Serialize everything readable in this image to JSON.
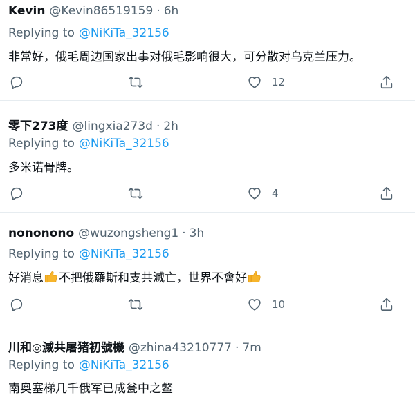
{
  "colors": {
    "mention": "#1d9bf0",
    "secondary_text": "#536471",
    "primary_text": "#0f1419",
    "divider": "#e6ecf0",
    "emoji": "#f7b52b"
  },
  "icons": [
    "reply-icon",
    "retweet-icon",
    "like-icon",
    "share-icon",
    "thumbs-up-emoji"
  ],
  "replies": [
    {
      "name": "Kevin",
      "handle": "@Kevin86519159",
      "dot": "·",
      "time": "6h",
      "replying_label": "Replying to",
      "replying_to": "@NiKiTa_32156",
      "text": "非常好，俄毛周边国家出事对俄毛影响很大，可分散对乌克兰压力。",
      "likes": "12"
    },
    {
      "name": "零下273度",
      "handle": "@lingxia273d",
      "dot": "·",
      "time": "2h",
      "replying_label": "Replying to",
      "replying_to": "@NiKiTa_32156",
      "text": "多米诺骨牌。",
      "likes": "4"
    },
    {
      "name": "nononono",
      "handle": "@wuzongsheng1",
      "dot": "·",
      "time": "3h",
      "replying_label": "Replying to",
      "replying_to": "@NiKiTa_32156",
      "text_before": "好消息",
      "text_middle": "不把俄羅斯和支共滅亡，世界不會好",
      "likes": "10"
    },
    {
      "name": "川和◎滅共屠猪初號機",
      "handle": "@zhina43210777",
      "dot": "·",
      "time": "7m",
      "replying_label": "Replying to",
      "replying_to": "@NiKiTa_32156",
      "text": "南奥塞梯几千俄军已成瓮中之鳖"
    }
  ]
}
